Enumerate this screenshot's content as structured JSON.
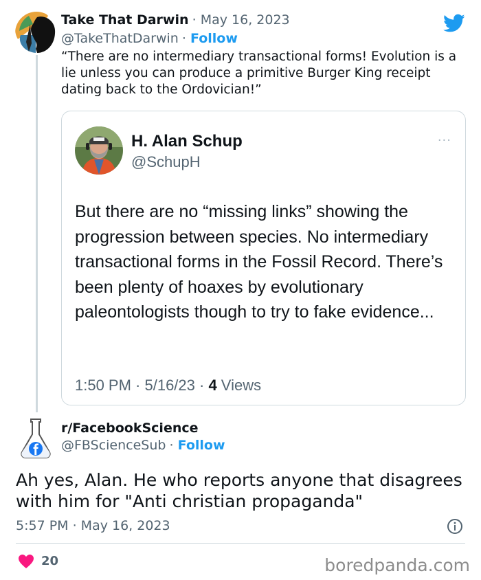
{
  "tweet1": {
    "name": "Take That Darwin",
    "date": "May 16, 2023",
    "handle": "@TakeThatDarwin",
    "follow": "Follow",
    "text": "“There are no intermediary transactional forms! Evolution is a lie unless you can produce a primitive Burger King receipt dating back to the Ordovician!”"
  },
  "quoted": {
    "name": "H. Alan Schup",
    "handle": "@SchupH",
    "menu": "···",
    "text": "But there are no “missing links” showing the progression between species.  No intermediary transactional forms in the Fossil Record. There’s been plenty of hoaxes by evolutionary paleontologists though to try to fake evidence...",
    "time": "1:50 PM · 5/16/23 · ",
    "views_count": "4",
    "views_label": " Views"
  },
  "tweet2": {
    "name": "r/FacebookScience",
    "handle": "@FBScienceSub",
    "follow": "Follow",
    "text": "Ah yes, Alan. He who reports anyone that disagrees with him for \"Anti christian propaganda\"",
    "time": "5:57 PM · May 16, 2023",
    "likes": "20"
  },
  "brand": "boredpanda.com",
  "icons": [
    "twitter-bird-icon",
    "info-icon",
    "heart-icon",
    "more-dots-icon"
  ],
  "colors": {
    "accent": "#1d9bf0",
    "heart": "#f91880",
    "muted": "#536471"
  }
}
